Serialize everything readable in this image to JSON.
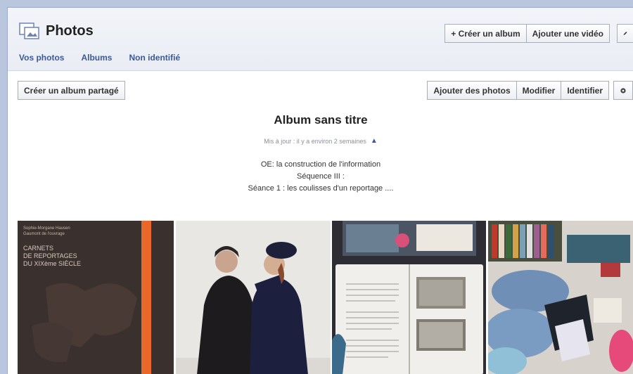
{
  "header": {
    "title": "Photos",
    "create_album": "+ Créer un album",
    "add_video": "Ajouter une vidéo",
    "edit_icon": "pencil-icon"
  },
  "tabs": [
    "Vos photos",
    "Albums",
    "Non identifié"
  ],
  "toolbar": {
    "shared_album": "Créer un album partagé",
    "add_photos": "Ajouter des photos",
    "modify": "Modifier",
    "tag": "Identifier",
    "settings_icon": "gear-icon"
  },
  "album": {
    "title": "Album sans titre",
    "updated": "Mis à jour : il y a environ 2 semaines",
    "desc_lines": [
      "OE: la construction de l'information",
      "Séquence III :",
      "Séance 1 : les coulisses d'un reportage ...."
    ]
  },
  "photos": [
    {
      "book_title": "CARNETS\nDE REPORTAGES\nDU XIXème SIÈCLE"
    },
    {},
    {},
    {}
  ],
  "colors": {
    "link": "#3b5998",
    "background": "#b9c6de",
    "book_cover": "#3a302d",
    "book_spine": "#e8682a"
  }
}
